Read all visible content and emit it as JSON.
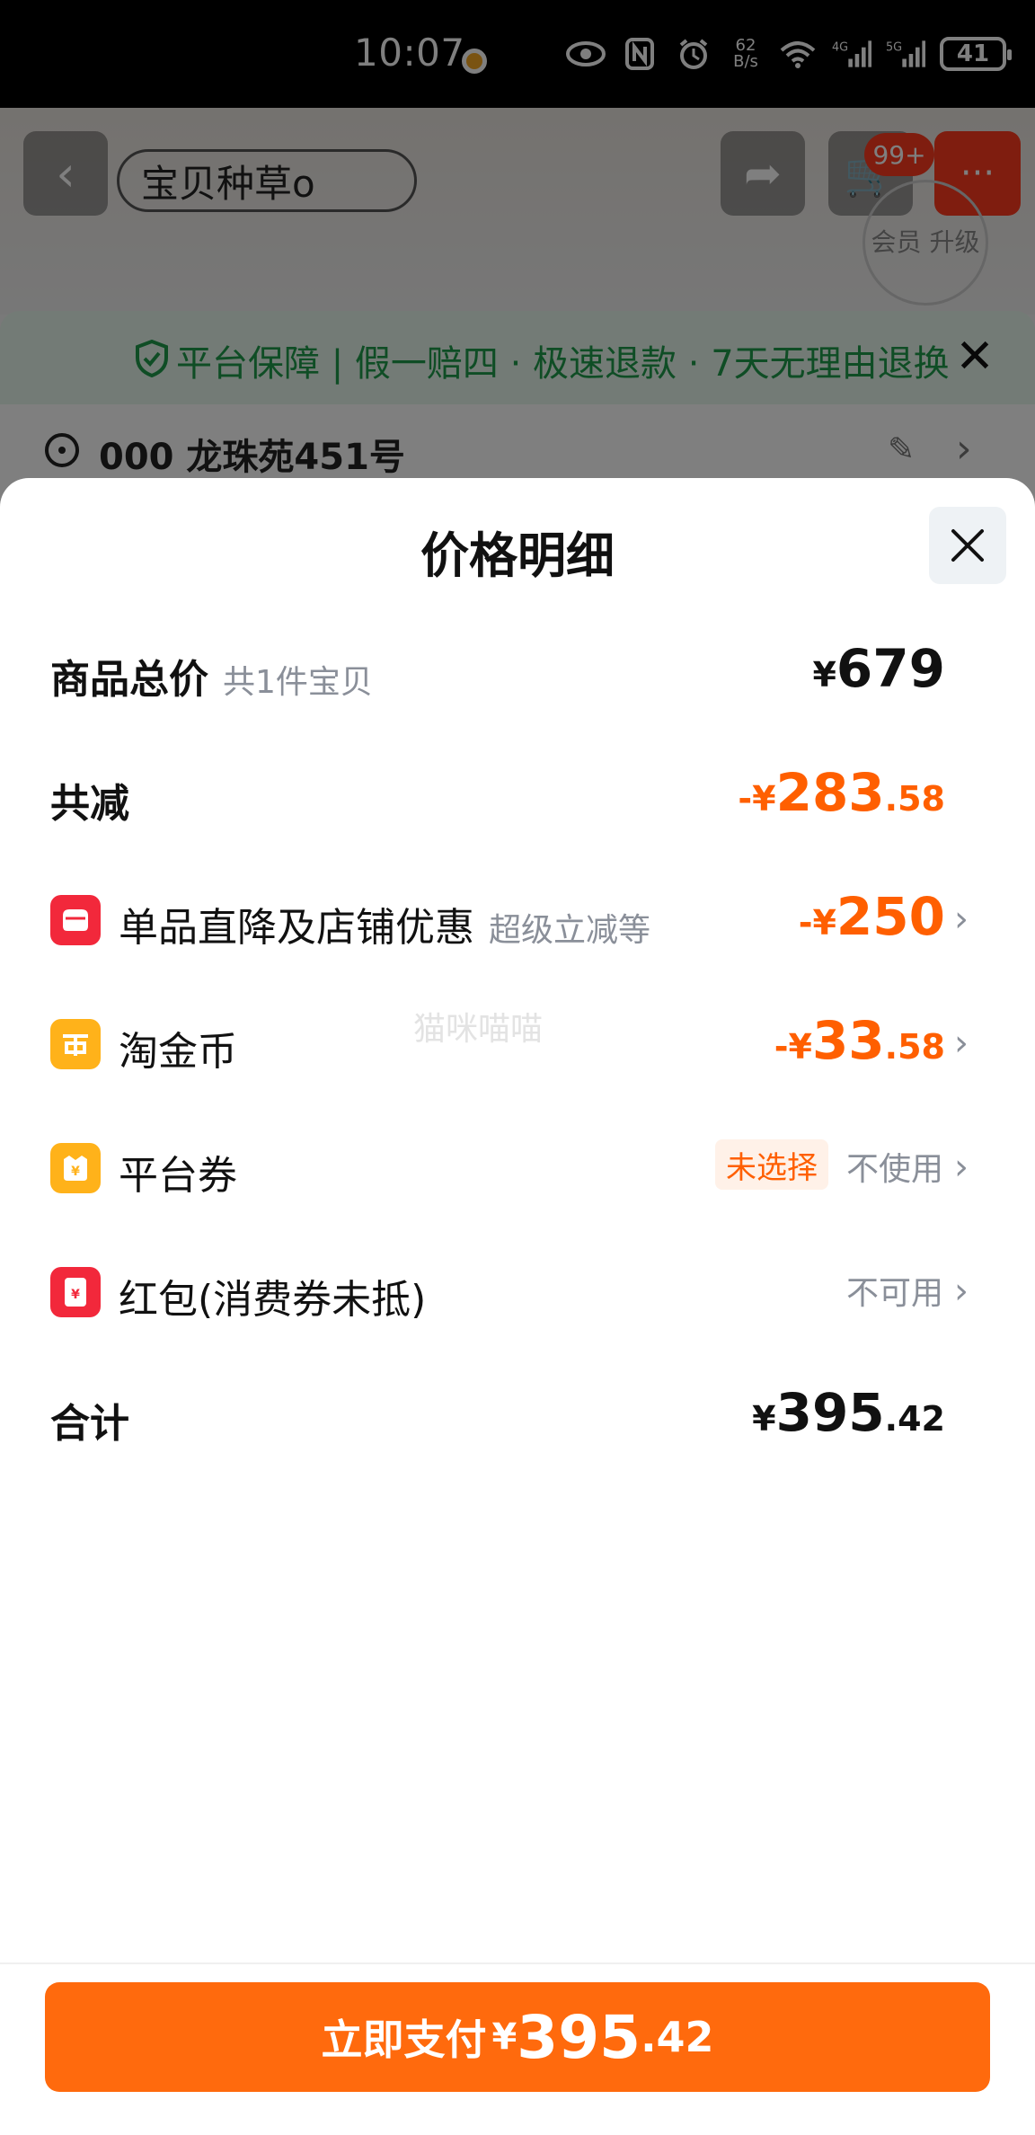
{
  "status_bar": {
    "time": "10:07",
    "net_speed_value": "62",
    "net_speed_unit": "B/s",
    "signal_1": "4G",
    "signal_2": "5G",
    "battery": "41"
  },
  "background": {
    "search_text": "宝贝种草o",
    "cart_badge": "99+",
    "upgrade_label": "会员 升级",
    "guarantee_text": "平台保障 | 假一赔四 · 极速退款 · 7天无理由退换",
    "address_text": "000 龙珠苑451号"
  },
  "sheet": {
    "title": "价格明细",
    "rows": {
      "subtotal": {
        "label": "商品总价",
        "sub": "共1件宝贝",
        "yen": "¥",
        "int": "679",
        "dec": ""
      },
      "total_discount": {
        "label": "共减",
        "yen": "-¥",
        "int": "283",
        "dec": ".58"
      },
      "store_discount": {
        "label": "单品直降及店铺优惠",
        "sub": "超级立减等",
        "yen": "-¥",
        "int": "250",
        "dec": ""
      },
      "coins": {
        "label": "淘金币",
        "yen": "-¥",
        "int": "33",
        "dec": ".58"
      },
      "platform_coupon": {
        "label": "平台券",
        "tag": "未选择",
        "status": "不使用"
      },
      "red_packet": {
        "label": "红包(消费券未抵)",
        "status": "不可用"
      },
      "sum": {
        "label": "合计",
        "yen": "¥",
        "int": "395",
        "dec": ".42"
      }
    },
    "watermark": "猫咪喵喵"
  },
  "pay_button": {
    "label": "立即支付",
    "yen": "¥",
    "int": "395",
    "dec": ".42"
  },
  "colors": {
    "accent_orange": "#ff6a0d",
    "discount_orange": "#ff5f00",
    "store_icon_red": "#f2283b",
    "coin_icon_yellow": "#ffb21a",
    "coupon_icon_yellow": "#ffb21a",
    "redpacket_icon_red": "#f2283b",
    "guarantee_green": "#1e9b4a"
  }
}
